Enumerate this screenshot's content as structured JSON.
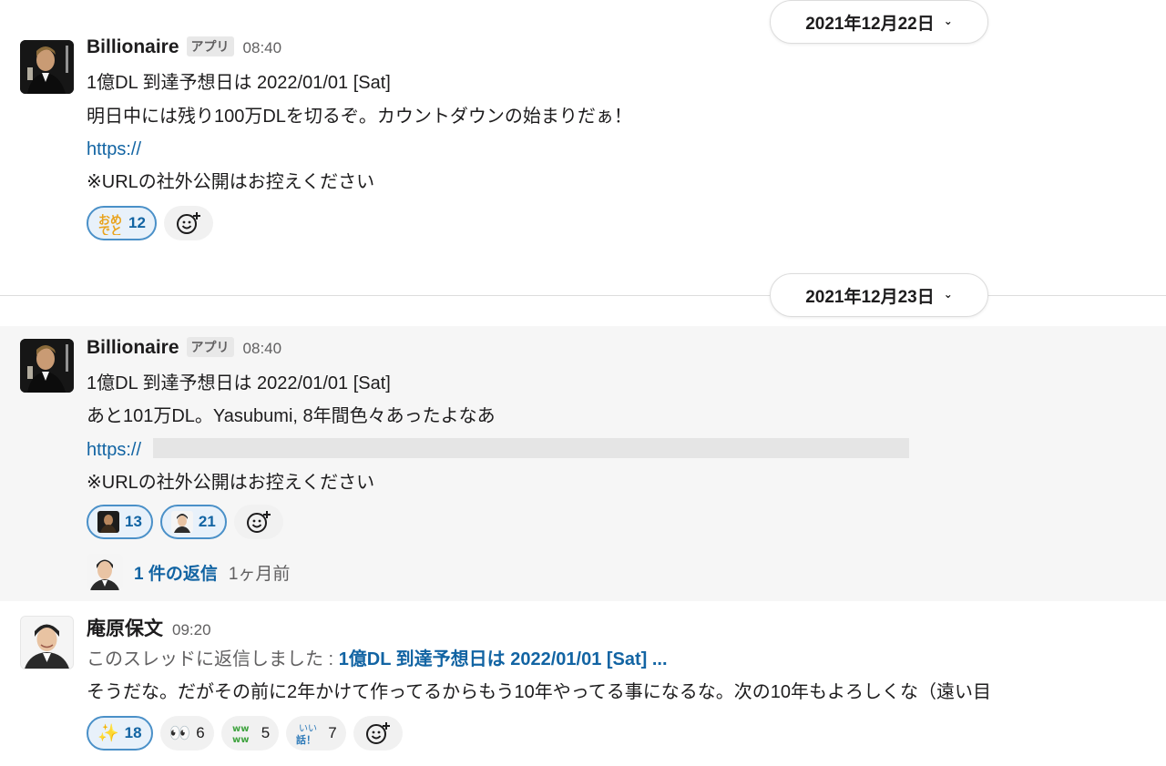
{
  "dividers": [
    {
      "date": "2021年12月22日"
    },
    {
      "date": "2021年12月23日"
    }
  ],
  "messages": [
    {
      "sender": "Billionaire",
      "badge": "アプリ",
      "time": "08:40",
      "lines": [
        "1億DL 到達予想日は 2022/01/01 [Sat]",
        "明日中には残り100万DLを切るぞ。カウントダウンの始まりだぁ！",
        "https://",
        "※URLの社外公開はお控えください"
      ],
      "reactions": [
        {
          "emoji": "おめでとう",
          "count": "12"
        }
      ]
    },
    {
      "sender": "Billionaire",
      "badge": "アプリ",
      "time": "08:40",
      "lines": [
        "1億DL 到達予想日は 2022/01/01 [Sat]",
        "あと101万DL。Yasubumi, 8年間色々あったよなあ",
        "https://",
        "※URLの社外公開はお控えください"
      ],
      "reactions": [
        {
          "emoji": "billionaire-avatar",
          "count": "13"
        },
        {
          "emoji": "person-avatar",
          "count": "21"
        }
      ],
      "thread": {
        "replies": "1 件の返信",
        "ago": "1ヶ月前"
      }
    },
    {
      "sender": "庵原保文",
      "time": "09:20",
      "reply_prefix": "このスレッドに返信しました :",
      "reply_ref": "1億DL 到達予想日は 2022/01/01 [Sat] ...",
      "body": "そうだな。だがその前に2年かけて作ってるからもう10年やってる事になるな。次の10年もよろしくな（遠い目",
      "reactions": [
        {
          "emoji": "✨",
          "count": "18"
        },
        {
          "emoji": "👀",
          "count": "6"
        },
        {
          "emoji": "ww ww",
          "count": "5"
        },
        {
          "emoji": "いい話！",
          "count": "7"
        }
      ]
    }
  ],
  "colors": {
    "link": "#1264a3",
    "mine_border": "#4a90c8",
    "highlight": "#f6f6f6"
  }
}
